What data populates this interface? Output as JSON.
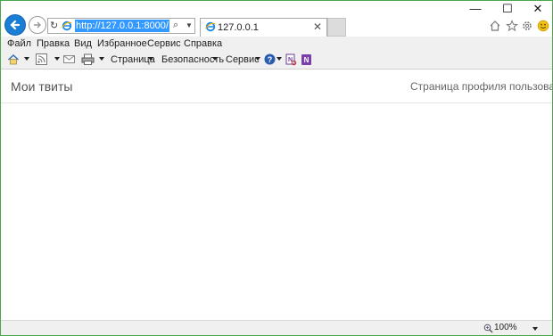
{
  "address_bar": {
    "url": "http://127.0.0.1:8000/"
  },
  "tab": {
    "title": "127.0.0.1"
  },
  "window_controls": {
    "minimize": "—",
    "maximize": "☐",
    "close": "✕"
  },
  "menu": [
    "Файл",
    "Правка",
    "Вид",
    "Избранное",
    "Сервис",
    "Справка"
  ],
  "command_bar": {
    "page": "Страница",
    "security": "Безопасность",
    "service": "Сервис"
  },
  "page": {
    "brand": "Мои твиты",
    "profile_link": "Страница профиля пользователя"
  },
  "status": {
    "zoom": "100%"
  },
  "icons": [
    "back-arrow-icon",
    "forward-arrow-icon",
    "refresh-icon",
    "ie-logo-icon",
    "search-icon",
    "home-icon",
    "star-icon",
    "gear-icon",
    "smiley-icon",
    "rss-icon",
    "mail-icon",
    "print-icon",
    "help-icon",
    "research-icon",
    "onenote-icon",
    "zoom-icon"
  ]
}
